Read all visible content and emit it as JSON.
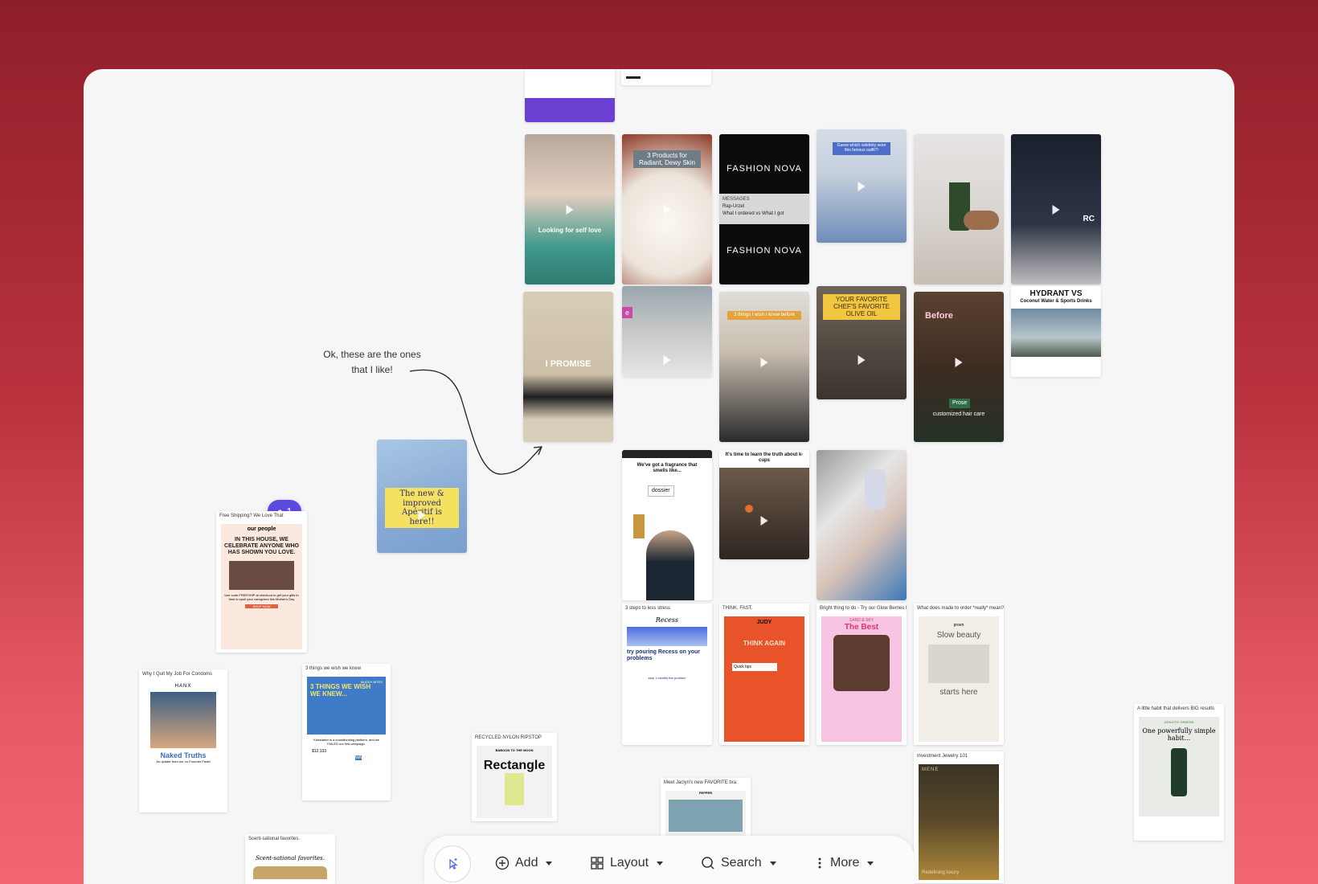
{
  "note": {
    "line1": "Ok, these are the ones",
    "line2": "that I like!"
  },
  "comment_badge": {
    "count": "1"
  },
  "toolbar": {
    "add": "Add",
    "layout": "Layout",
    "search": "Search",
    "more": "More"
  },
  "tiles": {
    "t1": "Looking for self love",
    "t2": "3 Products for Radiant, Dewy Skin",
    "t3a": "FASHION NOVA",
    "t3b": "MESSAGES",
    "t3c": "Rap-Urzel",
    "t3d": "What I ordered vs What I got",
    "t3e": "FASHION NOVA",
    "t4": "Guess which celebrity wore this famous outfit?!",
    "t6": "RC",
    "t7": "I PROMISE",
    "t8": "e",
    "t9": "3 things I wish I knew before",
    "t10": "YOUR FAVORITE CHEF'S FAVORITE OLIVE OIL",
    "t11a": "Before",
    "t11b": "Prose",
    "t11c": "customized hair care",
    "t12a": "HYDRANT VS",
    "t12b": "Coconut Water & Sports Drinks",
    "t13": "The new & improved Apéritif is here!!",
    "t14a": "We've got a fragrance that smells like...",
    "t14b": "dossier",
    "t15": "It's time to learn the truth about k-cups",
    "t16": ""
  },
  "emails": {
    "e1": {
      "subject": "Free Shipping? We Love That",
      "brand": "our people",
      "headline": "IN THIS HOUSE, WE CELEBRATE ANYONE WHO HAS SHOWN YOU LOVE.",
      "body": "Use code FREESHIP at checkout to get your gifts in time to spoil your caregivers this Mother's Day",
      "cta": "SHOP NOW"
    },
    "e2": {
      "subject": "Why I Quit My Job For Condoms",
      "brand": "HANX",
      "headline": "Naked Truths",
      "body": "An update from our co-Founder Farah"
    },
    "e3": {
      "subject": "3 things we wish we knew",
      "brand": "MUDDY BITES",
      "headline": "3 THINGS WE WISH WE KNEW...",
      "body": "Kickstarter is a crowdfunding platform, and we FAILED our first campaign.",
      "stat": "$12,133",
      "cta": "WATCH"
    },
    "e4": {
      "subject": "RECYCLED NYLON RIPSTOP",
      "brand": "BABOON TO THE MOON",
      "headline": "Rectangle"
    },
    "e5": {
      "subject": "3 steps to less stress",
      "brand": "Recess",
      "body": "try pouring Recess on your problems",
      "step": "step 1 identify the problem"
    },
    "e6": {
      "subject": "THINK. FAST.",
      "brand": "JUDY",
      "headline": "THINK AGAIN",
      "tip": "Quick tips"
    },
    "e7": {
      "subject": "Bright thing to do - Try our Glow Berries Rang",
      "brand": "SAND & SKY",
      "headline": "The Best"
    },
    "e8": {
      "subject": "What does made to order *really* mean?",
      "brand": "proen",
      "headline": "Slow beauty",
      "sub": "starts here"
    },
    "e9": {
      "subject": "Investment Jewelry 101",
      "brand": "MENE",
      "body": "Redefining luxury"
    },
    "e10": {
      "subject": "Meet Jaclyn's new FAVORITE bra.",
      "brand": "PEPPER"
    },
    "e11": {
      "subject": "Scent-sational favorites.",
      "headline": "Scent-sational favorites."
    },
    "e12": {
      "subject": "A little habit that delivers BIG results",
      "brand": "ATHLETIC GREENS",
      "headline": "One powerfully simple habit..."
    }
  }
}
